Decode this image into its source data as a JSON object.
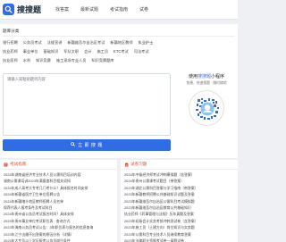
{
  "header": {
    "logo_text": "搜搜题",
    "nav": [
      "找答案",
      "最新试题",
      "考试指南",
      "试卷"
    ]
  },
  "categories": {
    "title": "题库分类",
    "tags": [
      "银行招聘",
      "公务员考试",
      "法规宣讲",
      "新疆维吾尔自治区考试",
      "新疆地区教师",
      "执业护士",
      "执业药师",
      "事业单位",
      "基础知识",
      "军队文职",
      "会计",
      "施工员",
      "ETC考试",
      "司法考试",
      "执业医师",
      "水利",
      "知识竞赛",
      "施工现场专业人员",
      "知识竞赛题库"
    ]
  },
  "question": {
    "placeholder": "请输入或粘贴题目内容"
  },
  "search_button": {
    "label": "立 即 搜 题"
  },
  "mini_program": {
    "title_prefix": "使用",
    "title_highlight": "搜搜题",
    "title_suffix": "小程序",
    "subtitle": "快捷、快速搜题 · 随时随地"
  },
  "left_panel": {
    "title": "考试指南",
    "items": [
      "2024年湖南省经济专业技术人员公需科目培训内容",
      "湖南公需课培训2023年满意度科目相关须知",
      "2024年成人高考大专考几门考什么？具体报名时间安排",
      "2024年新疆省医疗卫生单位招聘公告",
      "2024年新疆喀什地区教师招聘人员名单",
      "保荐代表人报考条件及考试科目",
      "2024年贵州省公务员考试报名时间？具体安排",
      "2024年贵州事业单位考试职位表 · 查询方式",
      "2023年海南公务员考试公告：3年职位表与报名的信息查询",
      "2023年江宁出缴不出答案的原因分析（详情）",
      "2023年大专及以上学历报考公务员岗位条件"
    ]
  },
  "right_panel": {
    "title": "试卷习题",
    "items": [
      "2024年中级经济师考试冲刺模拟题（含答案）",
      "2024年贵州公需课考试题目（带答案）",
      "2023年湖北公需科目答案与学习指南（带答案）",
      "2023年新疆教师招聘公共基础知识试题及答案",
      "2023年新疆维吾尔自治区公需科目考试模拟题",
      "2023年新疆维吾尔自治区教育公共基础知识",
      "执业药师《药事管理与法规》历年真题及答案",
      "2023年初级会计实务考前冲刺测试卷（含答案）",
      "2023年施工员（土建方向）岗位知识与实务题",
      "2023年公需科目专业技术人员继续教育答案",
      "2023年法律职业资格考试卷一真题试卷"
    ]
  }
}
